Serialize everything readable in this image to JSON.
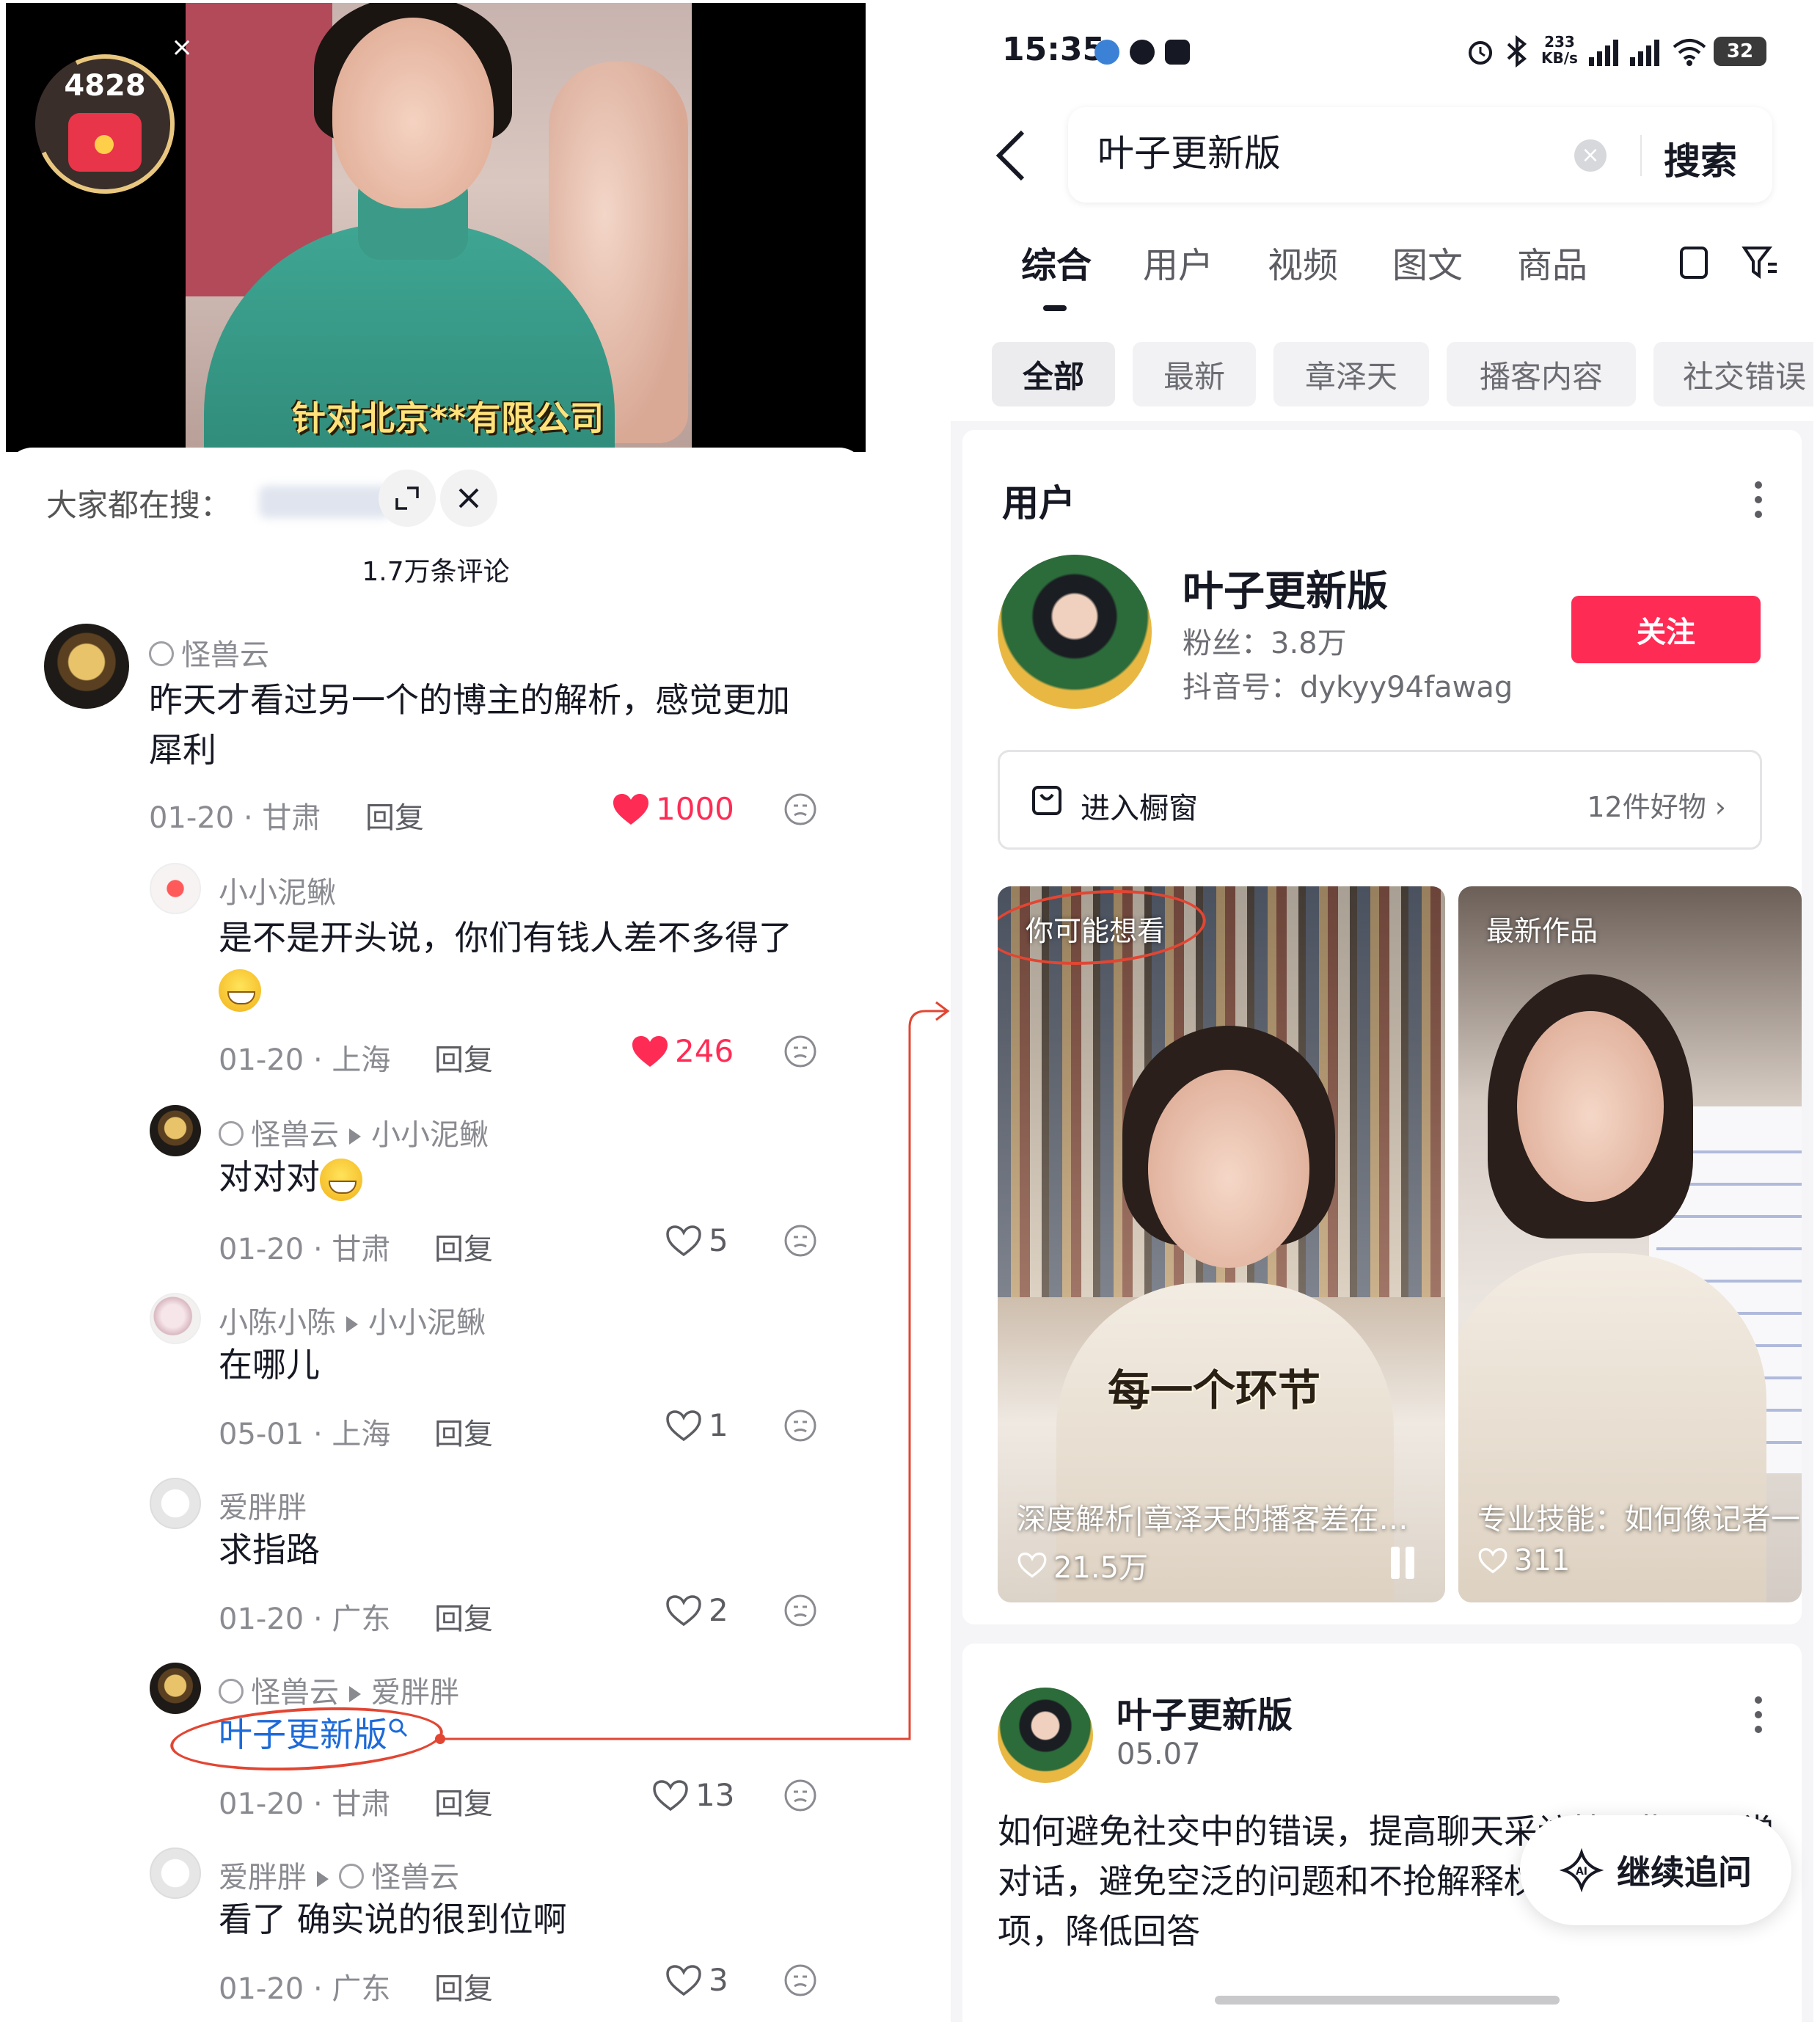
{
  "left": {
    "video": {
      "redpacket_count": "4828",
      "caption": "针对北京**有限公司",
      "close_glyph": "×"
    },
    "sheet": {
      "search_label": "大家都在搜：",
      "comment_count": "1.7万条评论"
    },
    "comments": [
      {
        "name": "怪兽云",
        "text": "昨天才看过另一个的博主的解析，感觉更加",
        "text2": "犀利",
        "date_loc": "01-20 · 甘肃",
        "reply": "回复",
        "likes": "1000",
        "liked": true
      },
      {
        "name": "小小泥鳅",
        "text": "是不是开头说，你们有钱人差不多得了",
        "date_loc": "01-20 · 上海",
        "reply": "回复",
        "likes": "246",
        "liked": true
      },
      {
        "name": "怪兽云",
        "to": "小小泥鳅",
        "text": "对对对",
        "date_loc": "01-20 · 甘肃",
        "reply": "回复",
        "likes": "5",
        "liked": false
      },
      {
        "name": "小陈小陈",
        "to": "小小泥鳅",
        "text": "在哪儿",
        "date_loc": "05-01 · 上海",
        "reply": "回复",
        "likes": "1",
        "liked": false
      },
      {
        "name": "爱胖胖",
        "text": "求指路",
        "date_loc": "01-20 · 广东",
        "reply": "回复",
        "likes": "2",
        "liked": false
      },
      {
        "name": "怪兽云",
        "to": "爱胖胖",
        "text": "叶子更新版",
        "date_loc": "01-20 · 甘肃",
        "reply": "回复",
        "likes": "13",
        "liked": false
      },
      {
        "name": "爱胖胖",
        "to": "怪兽云",
        "text": "看了 确实说的很到位啊",
        "date_loc": "01-20 · 广东",
        "reply": "回复",
        "likes": "3",
        "liked": false
      }
    ]
  },
  "right": {
    "status": {
      "time": "15:35",
      "speed_top": "233",
      "speed_bottom": "KB/s",
      "battery": "32"
    },
    "search": {
      "query": "叶子更新版",
      "submit": "搜索"
    },
    "tabs": [
      "综合",
      "用户",
      "视频",
      "图文",
      "商品"
    ],
    "chips": [
      "全部",
      "最新",
      "章泽天",
      "播客内容",
      "社交错误"
    ],
    "user_section": {
      "title": "用户",
      "name": "叶子更新版",
      "fans": "粉丝：3.8万",
      "douyin_id": "抖音号：dykyy94fawag",
      "follow": "关注",
      "shop_label": "进入橱窗",
      "shop_count": "12件好物"
    },
    "videos": [
      {
        "tag": "你可能想看",
        "overlay": "每一个环节",
        "title": "深度解析|章泽天的播客差在…",
        "likes": "21.5万"
      },
      {
        "tag": "最新作品",
        "title": "专业技能：如何像记者一",
        "likes": "311"
      }
    ],
    "post": {
      "author": "叶子更新版",
      "date": "05.07",
      "body": "如何避免社交中的错误，提高聊天采访技巧指导日常对话，避免空泛的问题和不抢解释权。提供具体选项，降低回答",
      "followup": "继续追问"
    }
  },
  "colors": {
    "accent_red": "#fe2c55",
    "annotation_red": "#e24633",
    "link_blue": "#1d6ad9"
  }
}
